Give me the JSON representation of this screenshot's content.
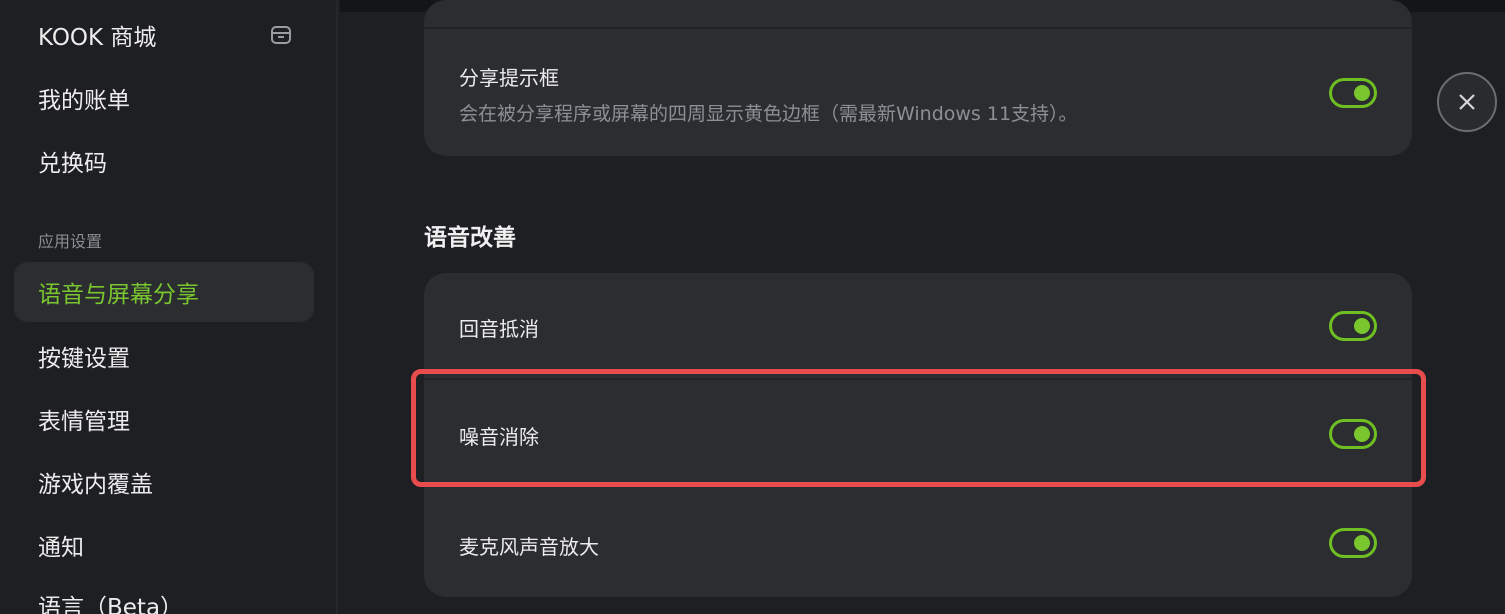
{
  "sidebar": {
    "items_top": [
      {
        "label": "KOOK 商城",
        "icon": "shop-icon"
      },
      {
        "label": "我的账单"
      },
      {
        "label": "兑换码"
      }
    ],
    "section_label": "应用设置",
    "items_app": [
      {
        "label": "语音与屏幕分享",
        "active": true
      },
      {
        "label": "按键设置"
      },
      {
        "label": "表情管理"
      },
      {
        "label": "游戏内覆盖"
      },
      {
        "label": "通知"
      },
      {
        "label": "语言（Beta）"
      }
    ]
  },
  "main": {
    "share_card": {
      "title": "分享提示框",
      "description": "会在被分享程序或屏幕的四周显示黄色边框（需最新Windows 11支持）。",
      "enabled": true
    },
    "voice_section": {
      "title": "语音改善",
      "rows": [
        {
          "label": "回音抵消",
          "enabled": true
        },
        {
          "label": "噪音消除",
          "enabled": true,
          "highlighted": true
        },
        {
          "label": "麦克风声音放大",
          "enabled": true
        }
      ]
    }
  },
  "close_icon": "close-icon",
  "colors": {
    "accent": "#7ac62f",
    "highlight": "#e84c4c",
    "card_bg": "#2b2d31",
    "page_bg": "#1e1f22"
  }
}
